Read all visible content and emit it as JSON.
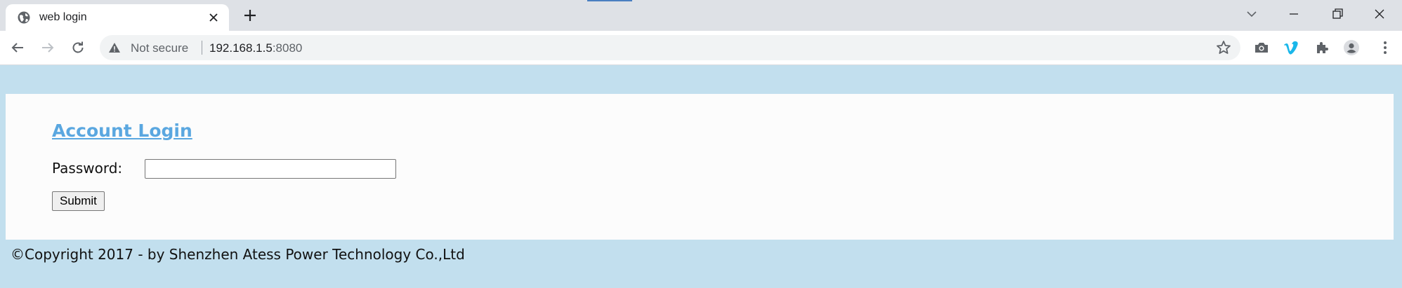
{
  "browser": {
    "tab": {
      "title": "web login",
      "favicon": "globe-icon"
    },
    "address_bar": {
      "security_status": "Not secure",
      "host": "192.168.1.5",
      "port": ":8080"
    },
    "icons": [
      "back-arrow-icon",
      "forward-arrow-icon",
      "reload-icon",
      "warning-icon",
      "star-icon",
      "camera-icon",
      "vimeo-icon",
      "extensions-icon",
      "profile-icon",
      "menu-dots-icon"
    ]
  },
  "page": {
    "title": "Account Login",
    "password_label": "Password:",
    "password_value": "",
    "submit_label": "Submit",
    "copyright": "©Copyright 2017 - by Shenzhen Atess Power Technology Co.,Ltd"
  },
  "colors": {
    "page_background": "#c2dfee",
    "panel_background": "#fcfcfc",
    "title_link": "#5aa7e0",
    "vimeo": "#1ab7ea"
  }
}
